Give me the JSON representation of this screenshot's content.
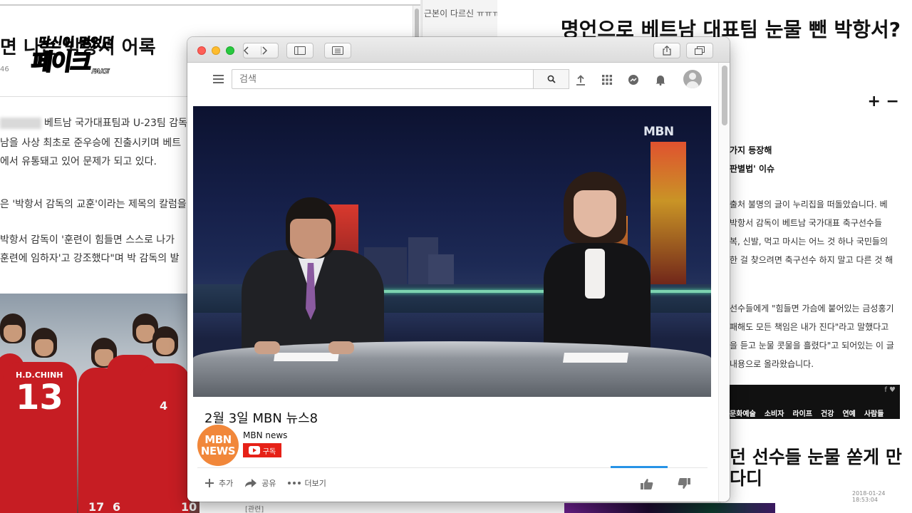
{
  "background": {
    "left_article": {
      "headline": "면 나는 박항서 어록",
      "meta": "46",
      "logo_line1": "당신이 믿었던",
      "logo_line2": "페이크",
      "logo_line3": "FAKE",
      "paragraphs": [
        "베트남 국가대표팀과 U-23팀 감독",
        "남을 사상 최초로 준우승에 진출시키며 베트",
        "에서 유통돼고 있어 문제가 되고 있다.",
        "은 '박항서 감독의 교훈'이라는 제목의 칼럼을",
        "박항서 감독이 '훈련이 힘들면 스스로 나가",
        "훈련에 임하자'고 강조했다\"며 박 감독의 발"
      ],
      "jersey_name": "H.D.CHINH",
      "jersey_number": "13",
      "jersey_numbers_back": [
        "4",
        "17",
        "6",
        "10"
      ]
    },
    "middle_caption": "근본이 다르신 ㅠㅠㅠ",
    "right_article": {
      "headline": "명언으로 베트남 대표팀 눈물 뺀 박항서?",
      "font_controls": "+ −",
      "lines": [
        {
          "text": "가지 등장해",
          "bold": true
        },
        {
          "text": "판별법' 이슈",
          "bold": true
        },
        {
          "text": "출처 불명의 글이 누리집을 떠돌았습니다. 베",
          "bold": false
        },
        {
          "text": "박항서 감독이 베트남 국가대표 축구선수들",
          "bold": false
        },
        {
          "text": "복, 신발, 먹고 마시는 어느 것 하나 국민들의",
          "bold": false
        },
        {
          "text": "한 걸 찾으려면 축구선수 하지 말고 다른 것 해",
          "bold": false
        },
        {
          "text": "선수들에게 \"힘들면 가슴에 붙어있는 금성홍기",
          "bold": false
        },
        {
          "text": "패해도 모든 책임은 내가 진다\"라고 말했다고",
          "bold": false
        },
        {
          "text": "을 듣고 눈물 콧물을 흘렸다\"고 되어있는 이 글",
          "bold": false
        },
        {
          "text": "내용으로 올라왔습니다.",
          "bold": false
        }
      ],
      "nav_items": [
        "문화예술",
        "소비자",
        "라이프",
        "건강",
        "연예",
        "사람들"
      ],
      "subhead_line1": "던 선수들 눈물 쏟게 만",
      "subhead_line2": "다디",
      "timestamp": "2018-01-24 18:53:04"
    },
    "bottom_strip_text": "[관련]"
  },
  "browser": {
    "search_placeholder": "검색",
    "video": {
      "watermark": "MBN",
      "title": "2월 3일 MBN 뉴스8"
    },
    "channel": {
      "logo_line1": "MBN",
      "logo_line2": "NEWS",
      "name": "MBN news",
      "subscribe_label": "구독"
    },
    "actions": {
      "add": "추가",
      "share": "공유",
      "more": "더보기"
    }
  },
  "colors": {
    "subscribe_red": "#e62117",
    "channel_orange": "#f1873a",
    "sentiment_blue": "#2793e6"
  }
}
